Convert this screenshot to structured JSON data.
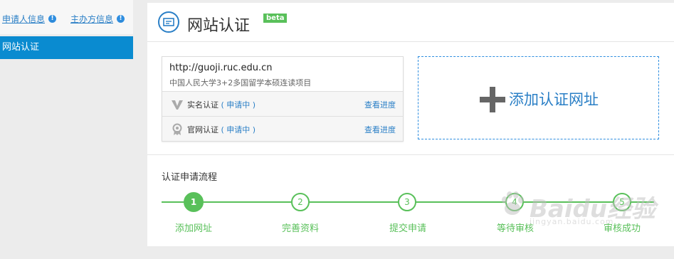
{
  "sidebar": {
    "link1_label": "申请人信息",
    "link2_label": "主办方信息",
    "info_glyph": "!",
    "active_item": "网站认证"
  },
  "header": {
    "title": "网站认证",
    "badge": "beta"
  },
  "site_card": {
    "url": "http://guoji.ruc.edu.cn",
    "name": "中国人民大学3+2多国留学本硕连读项目",
    "rows": [
      {
        "label": "实名认证",
        "status": "( 申请中 )",
        "link": "查看进度",
        "icon": "v-badge-icon"
      },
      {
        "label": "官网认证",
        "status": "( 申请中 )",
        "link": "查看进度",
        "icon": "ribbon-badge-icon"
      }
    ]
  },
  "add_box": {
    "label": "添加认证网址"
  },
  "process": {
    "title": "认证申请流程",
    "current_step": 1,
    "steps": [
      {
        "num": "1",
        "label": "添加网址"
      },
      {
        "num": "2",
        "label": "完善资料"
      },
      {
        "num": "3",
        "label": "提交申请"
      },
      {
        "num": "4",
        "label": "等待审核"
      },
      {
        "num": "5",
        "label": "审核成功"
      }
    ]
  },
  "watermark": {
    "brand": "Baidu经验",
    "url": "jingyan.baidu.com"
  },
  "colors": {
    "accent": "#2a7fc6",
    "active_nav": "#0a8bd0",
    "success": "#59c05a"
  }
}
